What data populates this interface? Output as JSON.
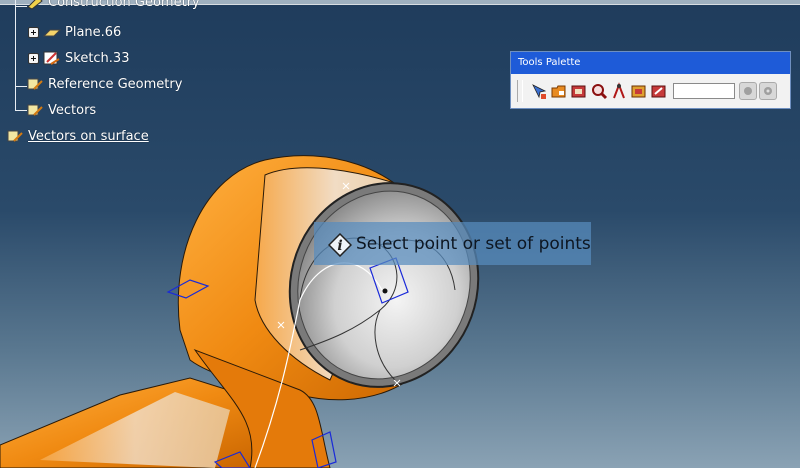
{
  "tree": {
    "items": [
      {
        "label": "Construction Geometry"
      },
      {
        "label": "Plane.66"
      },
      {
        "label": "Sketch.33"
      },
      {
        "label": "Reference Geometry"
      },
      {
        "label": "Vectors"
      },
      {
        "label": "Vectors on surface"
      }
    ]
  },
  "palette": {
    "title": "Tools Palette",
    "input_value": "",
    "tools": [
      "point-icon",
      "open-folder-icon",
      "image-icon",
      "magnifier-icon",
      "compass-icon",
      "folder-image-icon",
      "edit-image-icon"
    ]
  },
  "prompt": {
    "text": "Select point or set of points"
  },
  "colors": {
    "background_top": "#1f3c5c",
    "part_orange": "#f08a12",
    "palette_title": "#1e5bd8"
  }
}
